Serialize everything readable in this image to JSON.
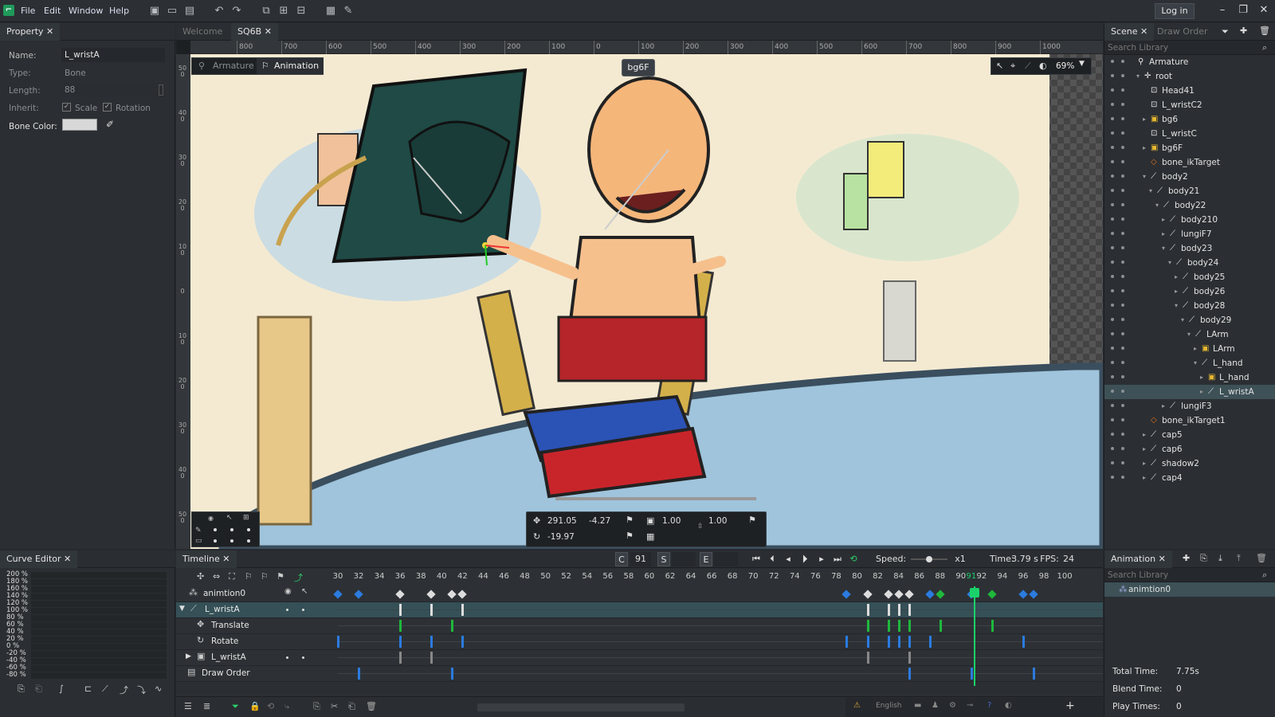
{
  "menubar": {
    "items": [
      "File",
      "Edit",
      "Window",
      "Help"
    ],
    "login": "Log in"
  },
  "property_panel": {
    "tab": "Property",
    "fields": [
      {
        "label": "Name:",
        "value": "L_wristA"
      },
      {
        "label": "Type:",
        "value": "Bone"
      },
      {
        "label": "Length:",
        "value": "88"
      },
      {
        "label": "Inherit:",
        "value": ""
      },
      {
        "label": "Bone Color:",
        "value": ""
      }
    ],
    "inherit_scale": "Scale",
    "inherit_rotation": "Rotation",
    "bone_color": "#d8d8d8"
  },
  "editor_tabs": [
    {
      "label": "Welcome",
      "active": false
    },
    {
      "label": "SQ6B",
      "active": true
    }
  ],
  "ruler_top": [
    "800",
    "700",
    "600",
    "500",
    "400",
    "300",
    "200",
    "100",
    "0",
    "100",
    "200",
    "300",
    "400",
    "500",
    "600",
    "700",
    "800",
    "900",
    "1000"
  ],
  "ruler_left": [
    "500",
    "400",
    "300",
    "200",
    "100",
    "0",
    "100",
    "200",
    "300",
    "400",
    "500"
  ],
  "mode_switch": {
    "armature": "Armature",
    "animation": "Animation"
  },
  "tooltip": "bg6F",
  "zoom": "69%",
  "transform": {
    "x": "291.05",
    "y": "-4.27",
    "rotation": "-19.97",
    "scale_x": "1.00",
    "scale_y": "1.00"
  },
  "scene_panel": {
    "tabs": [
      "Scene",
      "Draw Order"
    ],
    "search_placeholder": "Search Library",
    "tree": [
      {
        "label": "Armature",
        "depth": 0,
        "icon": "armature-icon",
        "arrow": ""
      },
      {
        "label": "root",
        "depth": 1,
        "icon": "root-icon",
        "arrow": "▾"
      },
      {
        "label": "Head41",
        "depth": 2,
        "icon": "slot-icon",
        "arrow": ""
      },
      {
        "label": "L_wristC2",
        "depth": 2,
        "icon": "slot-icon",
        "arrow": ""
      },
      {
        "label": "bg6",
        "depth": 2,
        "icon": "image-icon",
        "arrow": "▸"
      },
      {
        "label": "L_wristC",
        "depth": 2,
        "icon": "slot-icon",
        "arrow": ""
      },
      {
        "label": "bg6F",
        "depth": 2,
        "icon": "image-icon",
        "arrow": "▸"
      },
      {
        "label": "bone_ikTarget",
        "depth": 2,
        "icon": "ik-icon",
        "arrow": ""
      },
      {
        "label": "body2",
        "depth": 2,
        "icon": "bone-icon",
        "arrow": "▾"
      },
      {
        "label": "body21",
        "depth": 3,
        "icon": "bone-icon",
        "arrow": "▾"
      },
      {
        "label": "body22",
        "depth": 4,
        "icon": "bone-icon",
        "arrow": "▾"
      },
      {
        "label": "body210",
        "depth": 5,
        "icon": "bone-icon",
        "arrow": "▸"
      },
      {
        "label": "lungiF7",
        "depth": 5,
        "icon": "bone-icon",
        "arrow": "▸"
      },
      {
        "label": "body23",
        "depth": 5,
        "icon": "bone-icon",
        "arrow": "▾"
      },
      {
        "label": "body24",
        "depth": 6,
        "icon": "bone-icon",
        "arrow": "▾"
      },
      {
        "label": "body25",
        "depth": 7,
        "icon": "bone-icon",
        "arrow": "▸"
      },
      {
        "label": "body26",
        "depth": 7,
        "icon": "bone-icon",
        "arrow": "▸"
      },
      {
        "label": "body28",
        "depth": 7,
        "icon": "bone-icon",
        "arrow": "▾"
      },
      {
        "label": "body29",
        "depth": 8,
        "icon": "bone-icon",
        "arrow": "▾"
      },
      {
        "label": "LArm",
        "depth": 9,
        "icon": "bone-icon",
        "arrow": "▾"
      },
      {
        "label": "LArm",
        "depth": 10,
        "icon": "image-icon",
        "arrow": "▸"
      },
      {
        "label": "L_hand",
        "depth": 10,
        "icon": "bone-icon",
        "arrow": "▾"
      },
      {
        "label": "L_hand",
        "depth": 11,
        "icon": "image-icon",
        "arrow": "▸"
      },
      {
        "label": "L_wristA",
        "depth": 11,
        "icon": "bone-icon",
        "arrow": "▸",
        "selected": true
      },
      {
        "label": "lungiF3",
        "depth": 5,
        "icon": "bone-icon",
        "arrow": "▸"
      },
      {
        "label": "bone_ikTarget1",
        "depth": 2,
        "icon": "ik-icon",
        "arrow": ""
      },
      {
        "label": "cap5",
        "depth": 2,
        "icon": "bone-icon",
        "arrow": "▸"
      },
      {
        "label": "cap6",
        "depth": 2,
        "icon": "bone-icon",
        "arrow": "▸"
      },
      {
        "label": "shadow2",
        "depth": 2,
        "icon": "bone-icon",
        "arrow": "▸"
      },
      {
        "label": "cap4",
        "depth": 2,
        "icon": "bone-icon",
        "arrow": "▸"
      }
    ]
  },
  "curve_editor": {
    "tab": "Curve Editor",
    "labels": [
      "200 %",
      "180 %",
      "160 %",
      "140 %",
      "120 %",
      "100 %",
      "80 %",
      "60 %",
      "40 %",
      "20 %",
      "0 %",
      "-20 %",
      "-40 %",
      "-60 %",
      "-80 %"
    ]
  },
  "timeline": {
    "tab": "Timeline",
    "current_label": "C",
    "current_frame": "91",
    "start_label": "S",
    "end_label": "E",
    "speed_label": "Speed:",
    "speed_value": "x1",
    "time_label": "Time:",
    "time_value": "3.79 s",
    "fps_label": "FPS:",
    "fps_value": "24",
    "frames": [
      "30",
      "32",
      "34",
      "36",
      "38",
      "40",
      "42",
      "44",
      "46",
      "48",
      "50",
      "52",
      "54",
      "56",
      "58",
      "60",
      "62",
      "64",
      "66",
      "68",
      "70",
      "72",
      "74",
      "76",
      "78",
      "80",
      "82",
      "84",
      "86",
      "88",
      "90",
      "91",
      "92",
      "94",
      "96",
      "98",
      "100"
    ],
    "rows": [
      {
        "label": "animtion0",
        "kind": "anim"
      },
      {
        "label": "L_wristA",
        "kind": "bone"
      },
      {
        "label": "Translate",
        "kind": "translate"
      },
      {
        "label": "Rotate",
        "kind": "rotate"
      },
      {
        "label": "L_wristA",
        "kind": "slot"
      },
      {
        "label": "Draw Order",
        "kind": "draworder"
      }
    ],
    "footer_language": "English"
  },
  "animation_panel": {
    "tab": "Animation",
    "search_placeholder": "Search Library",
    "items": [
      "animtion0"
    ],
    "stats": [
      {
        "label": "Total Time:",
        "value": "7.75s"
      },
      {
        "label": "Blend Time:",
        "value": "0"
      },
      {
        "label": "Play Times:",
        "value": "0"
      }
    ]
  }
}
